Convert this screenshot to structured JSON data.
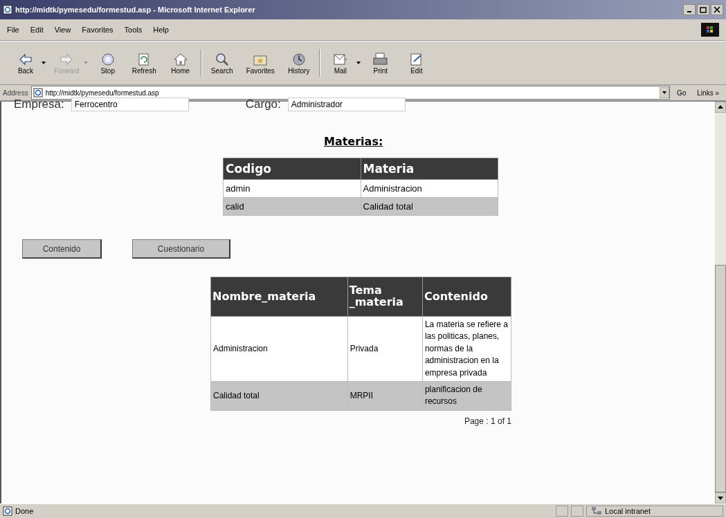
{
  "window": {
    "title": "http://midtk/pymesedu/formestud.asp - Microsoft Internet Explorer"
  },
  "menu": [
    "File",
    "Edit",
    "View",
    "Favorites",
    "Tools",
    "Help"
  ],
  "toolbar": [
    {
      "label": "Back",
      "disabled": false,
      "dropdown": true
    },
    {
      "label": "Forward",
      "disabled": true,
      "dropdown": true
    },
    {
      "label": "Stop",
      "disabled": false,
      "dropdown": false
    },
    {
      "label": "Refresh",
      "disabled": false,
      "dropdown": false
    },
    {
      "label": "Home",
      "disabled": false,
      "dropdown": false
    },
    {
      "label": "Search",
      "disabled": false,
      "dropdown": false
    },
    {
      "label": "Favorites",
      "disabled": false,
      "dropdown": false
    },
    {
      "label": "History",
      "disabled": false,
      "dropdown": false
    },
    {
      "label": "Mail",
      "disabled": false,
      "dropdown": true
    },
    {
      "label": "Print",
      "disabled": false,
      "dropdown": false
    },
    {
      "label": "Edit",
      "disabled": false,
      "dropdown": false
    }
  ],
  "address": {
    "label": "Address",
    "value": "http://midtk/pymesedu/formestud.asp",
    "go": "Go",
    "links": "Links »"
  },
  "form": [
    {
      "label": "Empresa:",
      "value": "Ferrocentro"
    },
    {
      "label": "Cargo:",
      "value": "Administrador"
    }
  ],
  "materias": {
    "heading": "Materias:",
    "columns": [
      "Codigo",
      "Materia"
    ],
    "rows": [
      [
        "admin",
        "Administracion"
      ],
      [
        "calid",
        "Calidad total"
      ]
    ]
  },
  "buttons": [
    "Contenido",
    "Cuestionario"
  ],
  "contenido": {
    "columns": [
      "Nombre_materia",
      "Tema _materia",
      "Contenido"
    ],
    "rows": [
      [
        "Administracion",
        "Privada",
        "La materia se refiere a las politicas, planes, normas de la administracion en la empresa privada"
      ],
      [
        "Calidad total",
        "MRPII",
        "planificacion de recursos"
      ]
    ],
    "pager": "Page : 1 of 1"
  },
  "status_bar": {
    "text": "Done",
    "zone": "Local intranet"
  }
}
